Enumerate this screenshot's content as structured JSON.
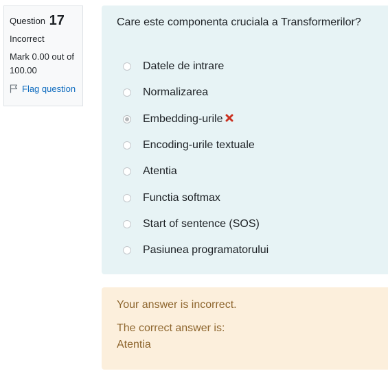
{
  "info": {
    "question_label": "Question",
    "question_number": "17",
    "state": "Incorrect",
    "grade": "Mark 0.00 out of 100.00",
    "flag_label": "Flag question"
  },
  "question": {
    "text": "Care este componenta cruciala a Transformerilor?",
    "options": [
      {
        "label": "Datele de intrare",
        "selected": false
      },
      {
        "label": "Normalizarea",
        "selected": false
      },
      {
        "label": "Embedding-urile",
        "selected": true,
        "mark": "incorrect"
      },
      {
        "label": "Encoding-urile textuale",
        "selected": false
      },
      {
        "label": "Atentia",
        "selected": false
      },
      {
        "label": "Functia softmax",
        "selected": false
      },
      {
        "label": "Start of sentence (SOS)",
        "selected": false
      },
      {
        "label": "Pasiunea programatorului",
        "selected": false
      }
    ]
  },
  "feedback": {
    "incorrect_text": "Your answer is incorrect.",
    "correct_answer_label": "The correct answer is:",
    "correct_answer": "Atentia"
  },
  "colors": {
    "formulation_bg": "#e7f3f5",
    "feedback_bg": "#fcefdc",
    "feedback_text": "#8e662e",
    "incorrect_mark": "#ca3120",
    "link": "#0f6cbf"
  }
}
